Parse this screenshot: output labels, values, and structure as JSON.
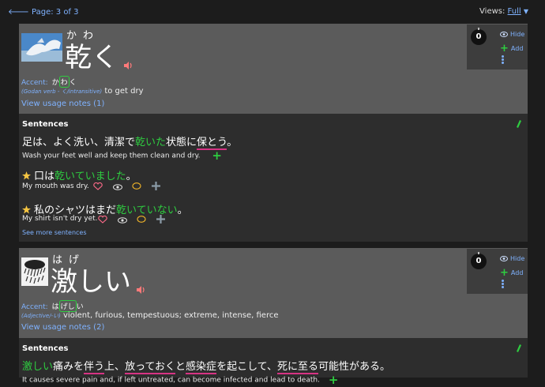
{
  "header": {
    "page_label": "Page: 3 of 3",
    "views_label": "Views:",
    "views_value": "Full"
  },
  "colors": {
    "accent_blue": "#7fb2ff",
    "green": "#2ecc40",
    "pink_underline": "#d63384",
    "card_head": "#5b5b5b",
    "card_body": "#2d2d2d"
  },
  "side_panel": {
    "count": "0",
    "hide_label": "Hide",
    "add_label": "Add"
  },
  "entries": [
    {
      "reading": "かわ",
      "word": "乾く",
      "accent_label": "Accent:",
      "accent_pre": "か",
      "accent_boxed": "わ",
      "accent_post": "く",
      "pos": "(Godan verb - く/intransitive)",
      "definition": "to get dry",
      "usage_notes": "View usage notes (1)",
      "sentences_title": "Sentences",
      "sentences": [
        {
          "jp": [
            "足は、よく洗い、清潔で",
            "乾いた",
            "状態に",
            "保とう",
            "。"
          ],
          "en": "Wash your feet well and keep them clean and dry."
        },
        {
          "jp": [
            "口は",
            "乾いていました",
            "。"
          ],
          "en": "My mouth was dry."
        },
        {
          "jp": [
            "私のシャツはまだ",
            "乾いていない",
            "。"
          ],
          "en": "My shirt isn't dry yet."
        }
      ],
      "see_more": "See more sentences"
    },
    {
      "reading": "はげ",
      "word": "激しい",
      "accent_label": "Accent:",
      "accent_pre": "は",
      "accent_boxed": "げし",
      "accent_post": "い",
      "pos": "(Adjective/-い)",
      "definition": "violent, furious, tempestuous; extreme, intense, fierce",
      "usage_notes": "View usage notes (2)",
      "sentences_title": "Sentences",
      "sentences": [
        {
          "jp": [
            "激しい",
            "痛みを",
            "伴う",
            "上、",
            "放っておく",
            "と",
            "感染症",
            "を起こして、",
            "死に至る",
            "可能性がある。"
          ],
          "en": "It causes severe pain and, if left untreated, can become infected and lead to death."
        }
      ]
    }
  ]
}
